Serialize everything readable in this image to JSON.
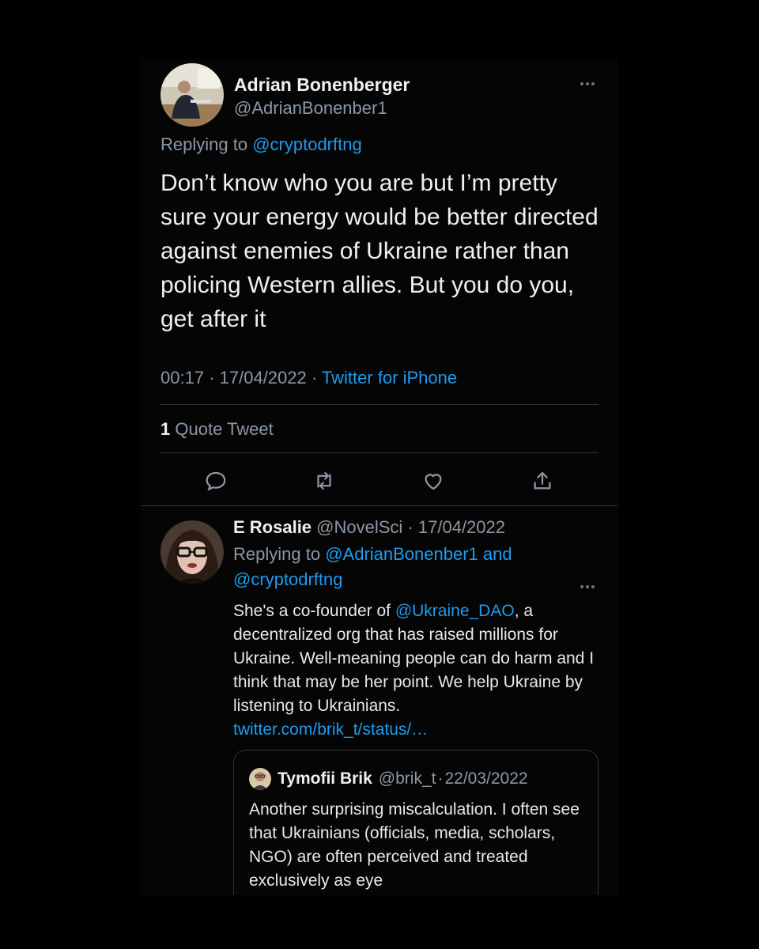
{
  "main_tweet": {
    "author_name": "Adrian Bonenberger",
    "author_handle": "@AdrianBonenber1",
    "replying_prefix": "Replying to",
    "replying_to": "@cryptodrftng",
    "text": "Don’t know who you are but I’m pretty sure your energy would be better directed against enemies of Ukraine rather than policing Western allies. But you do you, get after it",
    "time": "00:17",
    "separator": "·",
    "date": "17/04/2022",
    "source": "Twitter for iPhone",
    "quote_count": "1",
    "quote_label": "Quote Tweet",
    "actions": [
      "reply-icon",
      "retweet-icon",
      "like-icon",
      "share-icon"
    ]
  },
  "reply_tweet": {
    "author_name": "E Rosalie",
    "author_handle": "@NovelSci",
    "separator": "·",
    "date": "17/04/2022",
    "replying_prefix": "Replying to",
    "replying_to_1": "@AdrianBonenber1",
    "replying_and": "and",
    "replying_to_2": "@cryptodrftng",
    "text_before_mention": "She's a co-founder of ",
    "mention": "@Ukraine_DAO",
    "text_after_mention": ", a decentralized org that has raised millions for Ukraine. Well-meaning people can do harm and I think that may be her point. We help Ukraine by listening to Ukrainians.",
    "link": "twitter.com/brik_t/status/…",
    "quoted": {
      "author_name": "Tymofii Brik",
      "author_handle": "@brik_t",
      "separator": "·",
      "date": "22/03/2022",
      "text": "Another surprising miscalculation. I often see that Ukrainians (officials, media, scholars, NGO) are often perceived and treated exclusively as eye"
    }
  },
  "colors": {
    "background": "#000000",
    "panel": "#050505",
    "text": "#e7e9ea",
    "muted": "#8b98a5",
    "link": "#1d9bf0",
    "divider": "#2f3336"
  }
}
